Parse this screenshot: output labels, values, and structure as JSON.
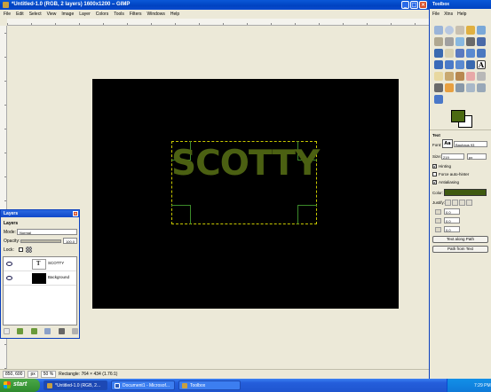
{
  "window": {
    "title": "*Untitled-1.0 (RGB, 2 layers) 1600x1200 – GIMP"
  },
  "menu": [
    "File",
    "Edit",
    "Select",
    "View",
    "Image",
    "Layer",
    "Colors",
    "Tools",
    "Filters",
    "Windows",
    "Help"
  ],
  "canvas": {
    "text_layer_content": "SCOTTY",
    "text_color": "#4b6012",
    "image_bg_color": "#000000"
  },
  "status": {
    "coords": "850, 600",
    "unit": "px",
    "zoom": "50 %",
    "message": "Rectangle: 764 × 434  (1.76:1)"
  },
  "layers_dialog": {
    "title": "Layers",
    "header": "Layers",
    "mode_label": "Mode:",
    "mode_value": "Normal",
    "opacity_label": "Opacity:",
    "opacity_value": "100.0",
    "lock_label": "Lock:",
    "layers": [
      {
        "name": "SCOTTY",
        "thumb": "text-icon"
      },
      {
        "name": "Background",
        "thumb": "black-fill"
      }
    ]
  },
  "toolbox": {
    "title": "Toolbox",
    "fg_color": "#4b6a12",
    "bg_color": "#ffffff",
    "text_options": {
      "header": "Text",
      "font_label": "Font:",
      "font_value": "Bauhaus 93",
      "size_label": "Size:",
      "size_value": "219",
      "size_unit": "px",
      "hinting": "Hinting",
      "force_autohinter": "Force auto-hinter",
      "antialiasing": "Antialiasing",
      "color_label": "Color:",
      "color_value": "#3f5a10",
      "justify_label": "Justify:",
      "indent_value": "0.0",
      "line_spacing_value": "0.0",
      "letter_spacing_value": "0.0",
      "text_along_path": "Text along Path",
      "path_from_text": "Path from Text"
    }
  },
  "taskbar": {
    "start": "start",
    "tasks": [
      "*Untitled-1.0 (RGB, 2...",
      "Document1 - Microsof...",
      "Toolbox"
    ],
    "clock": "7:29 PM"
  }
}
